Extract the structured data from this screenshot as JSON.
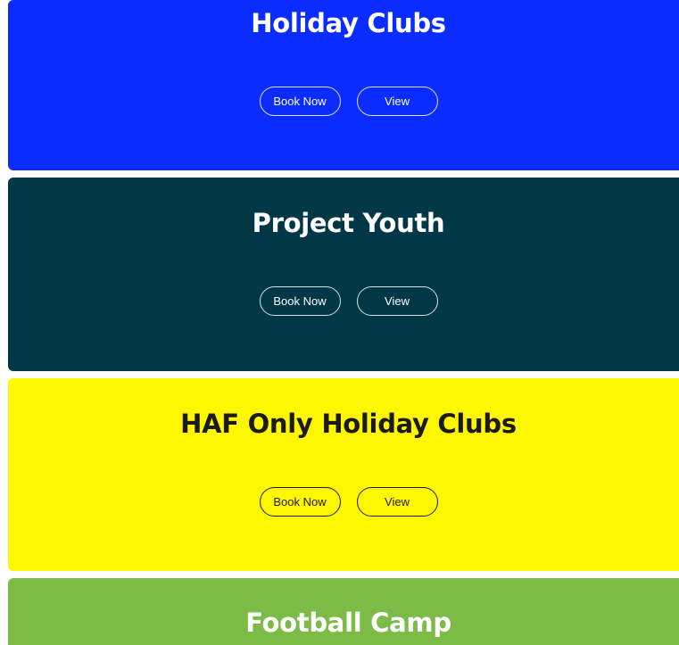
{
  "cards": [
    {
      "title": "Holiday Clubs",
      "background": "#0a2cff",
      "text_color": "#ffffff",
      "book_label": "Book Now",
      "view_label": "View"
    },
    {
      "title": "Project Youth",
      "background": "#023747",
      "text_color": "#ffffff",
      "book_label": "Book Now",
      "view_label": "View"
    },
    {
      "title": "HAF Only Holiday Clubs",
      "background": "#fff700",
      "text_color": "#1b1b1b",
      "book_label": "Book Now",
      "view_label": "View"
    },
    {
      "title": "Football Camp",
      "background": "#7cbb45",
      "text_color": "#ffffff"
    }
  ]
}
